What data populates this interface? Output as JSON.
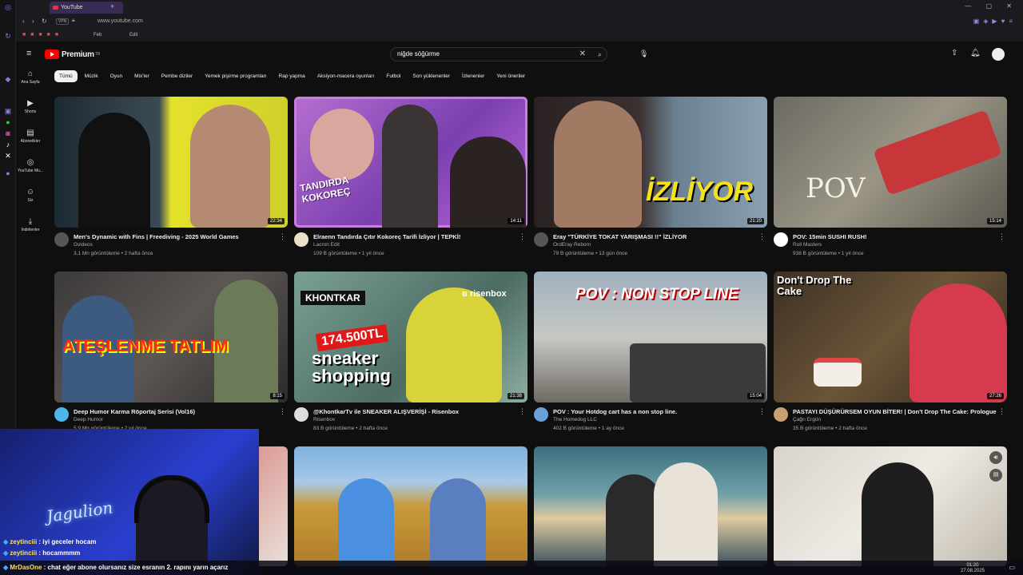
{
  "browser": {
    "tab_title": "YouTube",
    "url": "www.youtube.com",
    "vpn_label": "VPN",
    "bookmarks": [
      "Feb",
      "Edit"
    ]
  },
  "header": {
    "logo_text": "Premium",
    "logo_sup": "TR",
    "search_value": "niğde söğürme"
  },
  "nav": [
    {
      "label": "Ana Sayfa",
      "icon": "home-icon"
    },
    {
      "label": "Shorts",
      "icon": "shorts-icon"
    },
    {
      "label": "Abonelikler",
      "icon": "subscriptions-icon"
    },
    {
      "label": "YouTube Mu...",
      "icon": "music-icon"
    },
    {
      "label": "Siz",
      "icon": "user-icon"
    },
    {
      "label": "İndirilenler",
      "icon": "download-icon"
    }
  ],
  "chips": [
    "Tümü",
    "Müzik",
    "Oyun",
    "Mix'ler",
    "Pembe diziler",
    "Yemek pişirme programları",
    "Rap yapma",
    "Aksiyon-macera oyunları",
    "Futbol",
    "Son yüklenenler",
    "İzlenenler",
    "Yeni öneriler"
  ],
  "videos": [
    {
      "title": "Men's Dynamic with Fins | Freediving - 2025 World Games",
      "channel": "Gvideos",
      "stats": "3,1 Mn görüntüleme • 2 hafta önce",
      "duration": "22:34",
      "overlay": ""
    },
    {
      "title": "Elraenn Tandırda Çıtır Kokoreç Tarifi İzliyor | TEPKİ!",
      "channel": "Lacron Edit",
      "stats": "109 B görüntüleme • 1 yıl önce",
      "duration": "14:11",
      "overlay": "TANDIRDA KOKOREÇ"
    },
    {
      "title": "Eray \"TÜRKİYE TOKAT YARIŞMASI !!\" İZLİYOR",
      "channel": "OrdEray Reborn",
      "stats": "79 B görüntüleme • 13 gün önce",
      "duration": "21:20",
      "overlay": "İZLİYOR"
    },
    {
      "title": "POV: 15min SUSHI RUSH!",
      "channel": "Roll Masters",
      "stats": "938 B görüntüleme • 1 yıl önce",
      "duration": "15:14",
      "overlay": "POV"
    },
    {
      "title": "Deep Humor Karma Röportaj Serisi (Vol16)",
      "channel": "Deep Humor",
      "stats": "5,9 Mn görüntüleme • 2 yıl önce",
      "duration": "8:15",
      "overlay": "ATEŞLENME TATLIM"
    },
    {
      "title": "@KhontkarTv ile SNEAKER ALIŞVERİŞİ - Risenbox",
      "channel": "Risenbox",
      "stats": "83 B görüntüleme • 2 hafta önce",
      "duration": "21:38",
      "overlay": "sneaker shopping"
    },
    {
      "title": "POV : Your Hotdog cart has a non stop line.",
      "channel": "The Homedog LLC",
      "stats": "402 B görüntüleme • 1 ay önce",
      "duration": "15:04",
      "overlay": "POV : NON STOP LINE"
    },
    {
      "title": "PASTAYI DÜŞÜRÜRSEM OYUN BİTER! | Don't Drop The Cake: Prologue",
      "channel": "Çağrı Ergün",
      "stats": "35 B görüntüleme • 2 hafta önce",
      "duration": "27:26",
      "overlay": "Don't Drop The Cake"
    }
  ],
  "chat": [
    {
      "user": "zeytinciii",
      "text": "iyi geceler hocam"
    },
    {
      "user": "zeytinciii",
      "text": "hocammmm"
    },
    {
      "user": "MrDasOne",
      "text": "chat eğer abone olursanız size esranın 2. rapını yarın açarız"
    }
  ],
  "webcam_sign": "Jagulion",
  "clock": {
    "time": "01:20",
    "date": "27.08.2025"
  },
  "colors": {
    "accent": "#ff0000",
    "chat_user": "#ffe15a"
  }
}
